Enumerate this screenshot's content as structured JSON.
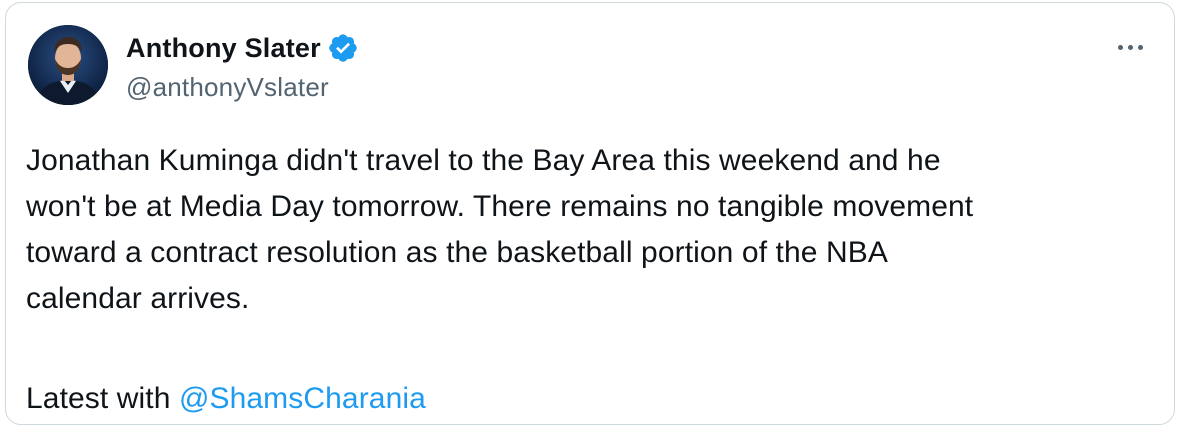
{
  "author": {
    "display_name": "Anthony Slater",
    "handle": "@anthonyVslater",
    "verified": true,
    "verified_color": "#1d9bf0"
  },
  "menu": {
    "more_icon": "more-horizontal-icon"
  },
  "tweet": {
    "text": "Jonathan Kuminga didn't travel to the Bay Area this weekend and he\nwon't be at Media Day tomorrow. There remains no tangible movement\ntoward a contract resolution as the basketball portion of the NBA\ncalendar arrives.",
    "latest_prefix": "Latest with ",
    "mention": "@ShamsCharania",
    "mention_color": "#1d9bf0"
  }
}
